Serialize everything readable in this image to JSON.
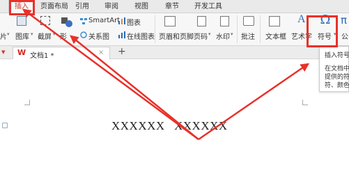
{
  "menubar": {
    "tabs": [
      {
        "label": "插入"
      },
      {
        "label": "页面布局"
      },
      {
        "label": "引用"
      },
      {
        "label": "审阅"
      },
      {
        "label": "视图"
      },
      {
        "label": "章节"
      },
      {
        "label": "开发工具"
      }
    ]
  },
  "ribbon": {
    "picture_label": "片",
    "screenshot_label": "截屏",
    "shape_label": "形",
    "gallery_label": "图库",
    "smartart_label": "SmartArt",
    "chart_label": "图表",
    "relation_label": "关系图",
    "online_chart_label": "在线图表",
    "header_footer_label": "页眉和页脚",
    "page_number_label": "页码",
    "watermark_label": "水印",
    "comment_label": "批注",
    "textbox_label": "文本框",
    "art_label": "艺术字",
    "symbol_label": "符号",
    "symbol_glyph": "Ω",
    "formula_label": "公"
  },
  "tabstrip": {
    "doc_tab_label": "文档1 *",
    "add_tab": "+"
  },
  "tooltip": {
    "title": "插入符号",
    "line1": "在文档中",
    "line2": "提供的符",
    "line3": "符、颜色"
  },
  "document": {
    "text_a": "XXXXXX",
    "text_b": "XXXXXX"
  },
  "colors": {
    "annotation_red": "#e8312a",
    "active_tab_text": "#d23a2a",
    "icon_blue": "#2a6ab8"
  }
}
